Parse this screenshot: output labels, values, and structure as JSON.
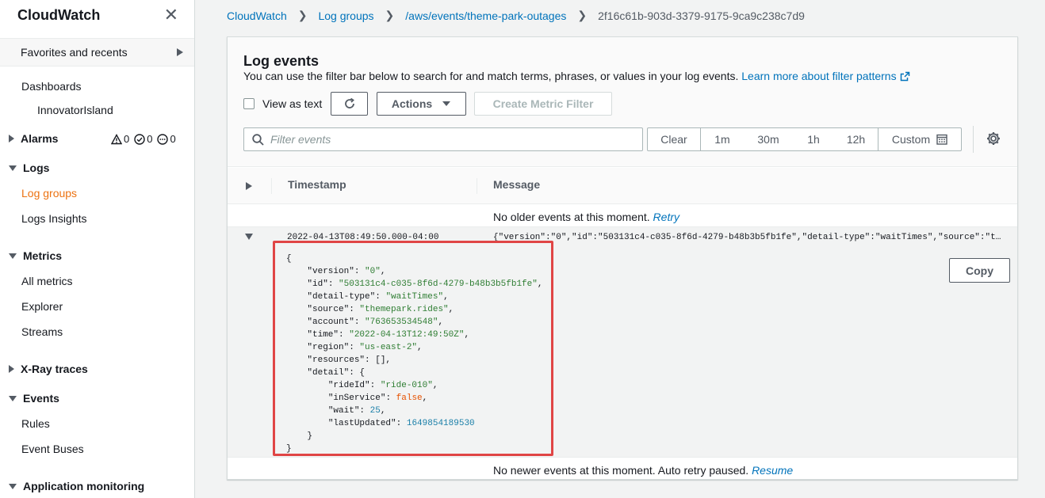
{
  "sidebar": {
    "title": "CloudWatch",
    "favorites": "Favorites and recents",
    "dashboards": "Dashboards",
    "innovator": "InnovatorIsland",
    "alarms": {
      "label": "Alarms",
      "alarm_count": "0",
      "ok_count": "0",
      "insufficient_count": "0"
    },
    "logs": "Logs",
    "log_groups": "Log groups",
    "logs_insights": "Logs Insights",
    "metrics": "Metrics",
    "all_metrics": "All metrics",
    "explorer": "Explorer",
    "streams": "Streams",
    "xray": "X-Ray traces",
    "events": "Events",
    "rules": "Rules",
    "event_buses": "Event Buses",
    "app_monitoring": "Application monitoring"
  },
  "breadcrumb": {
    "items": [
      "CloudWatch",
      "Log groups",
      "/aws/events/theme-park-outages"
    ],
    "current": "2f16c61b-903d-3379-9175-9ca9c238c7d9"
  },
  "panel": {
    "title": "Log events",
    "description": "You can use the filter bar below to search for and match terms, phrases, or values in your log events.",
    "learn_more": "Learn more about filter patterns",
    "view_as_text": "View as text",
    "actions": "Actions",
    "create_metric_filter": "Create Metric Filter",
    "filter_placeholder": "Filter events",
    "time_buttons": {
      "clear": "Clear",
      "m1": "1m",
      "m30": "30m",
      "h1": "1h",
      "h12": "12h",
      "custom": "Custom"
    }
  },
  "table": {
    "col_timestamp": "Timestamp",
    "col_message": "Message",
    "no_older": "No older events at this moment.",
    "retry": "Retry",
    "no_newer": "No newer events at this moment. Auto retry paused.",
    "resume": "Resume",
    "copy": "Copy"
  },
  "event": {
    "timestamp": "2022-04-13T08:49:50.000-04:00",
    "message": "{\"version\":\"0\",\"id\":\"503131c4-c035-8f6d-4279-b48b3b5fb1fe\",\"detail-type\":\"waitTimes\",\"source\":\"t…",
    "json": {
      "open": "{",
      "version_k": "\"version\"",
      "version_v": "\"0\"",
      "id_k": "\"id\"",
      "id_v": "\"503131c4-c035-8f6d-4279-b48b3b5fb1fe\"",
      "dt_k": "\"detail-type\"",
      "dt_v": "\"waitTimes\"",
      "source_k": "\"source\"",
      "source_v": "\"themepark.rides\"",
      "account_k": "\"account\"",
      "account_v": "\"763653534548\"",
      "time_k": "\"time\"",
      "time_v": "\"2022-04-13T12:49:50Z\"",
      "region_k": "\"region\"",
      "region_v": "\"us-east-2\"",
      "resources_k": "\"resources\"",
      "resources_v": "[],",
      "detail_k": "\"detail\"",
      "detail_v": "{",
      "rideId_k": "\"rideId\"",
      "rideId_v": "\"ride-010\"",
      "inService_k": "\"inService\"",
      "inService_v": "false",
      "wait_k": "\"wait\"",
      "wait_v": "25",
      "lastUpdated_k": "\"lastUpdated\"",
      "lastUpdated_v": "1649854189530",
      "inner_close": "}",
      "close": "}"
    }
  },
  "colors": {
    "link": "#0073bb",
    "active_nav": "#ec7211",
    "highlight": "#e04545"
  }
}
